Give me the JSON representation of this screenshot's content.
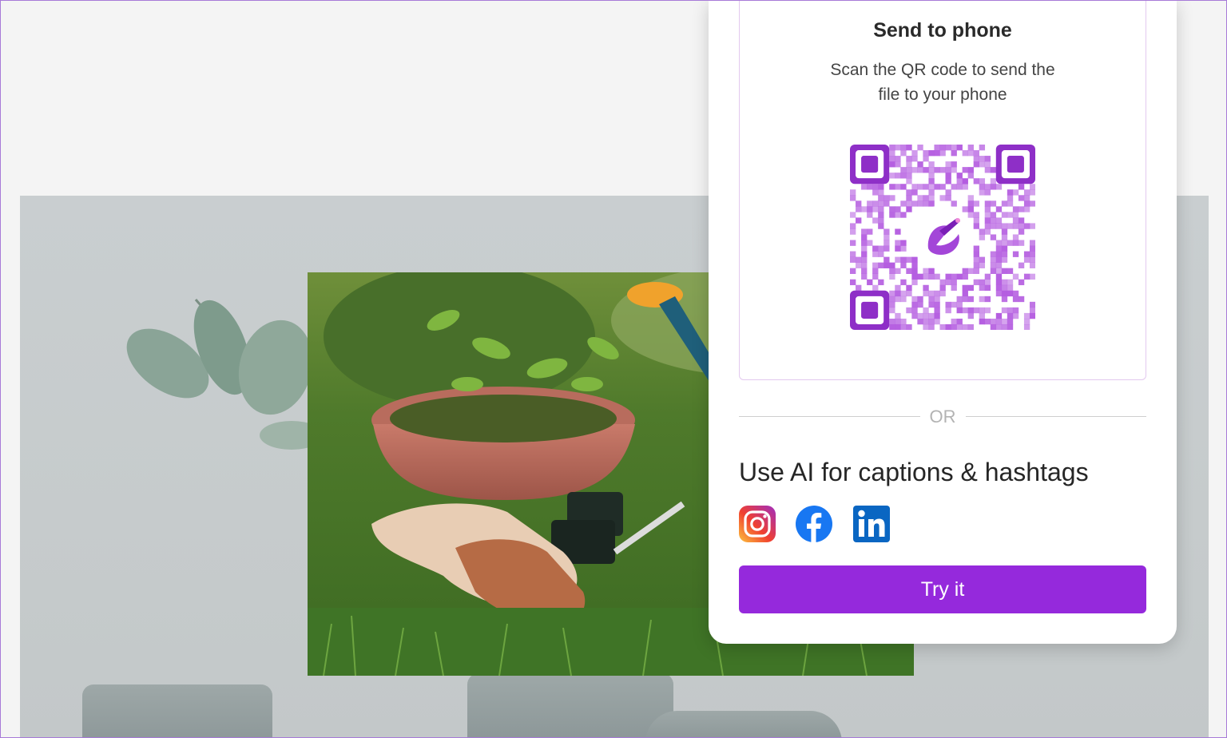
{
  "send_to_phone": {
    "title": "Send to phone",
    "subtitle": "Scan the QR code to send the file to your phone"
  },
  "divider": {
    "text": "OR"
  },
  "ai_captions": {
    "title": "Use AI for captions & hashtags",
    "socials": [
      {
        "name": "Instagram",
        "icon": "instagram-icon"
      },
      {
        "name": "Facebook",
        "icon": "facebook-icon"
      },
      {
        "name": "LinkedIn",
        "icon": "linkedin-icon"
      }
    ],
    "try_label": "Try it"
  },
  "colors": {
    "accent": "#9529dc",
    "qr": "#b45ce0",
    "facebook": "#1877f2",
    "linkedin": "#0a66c2"
  }
}
